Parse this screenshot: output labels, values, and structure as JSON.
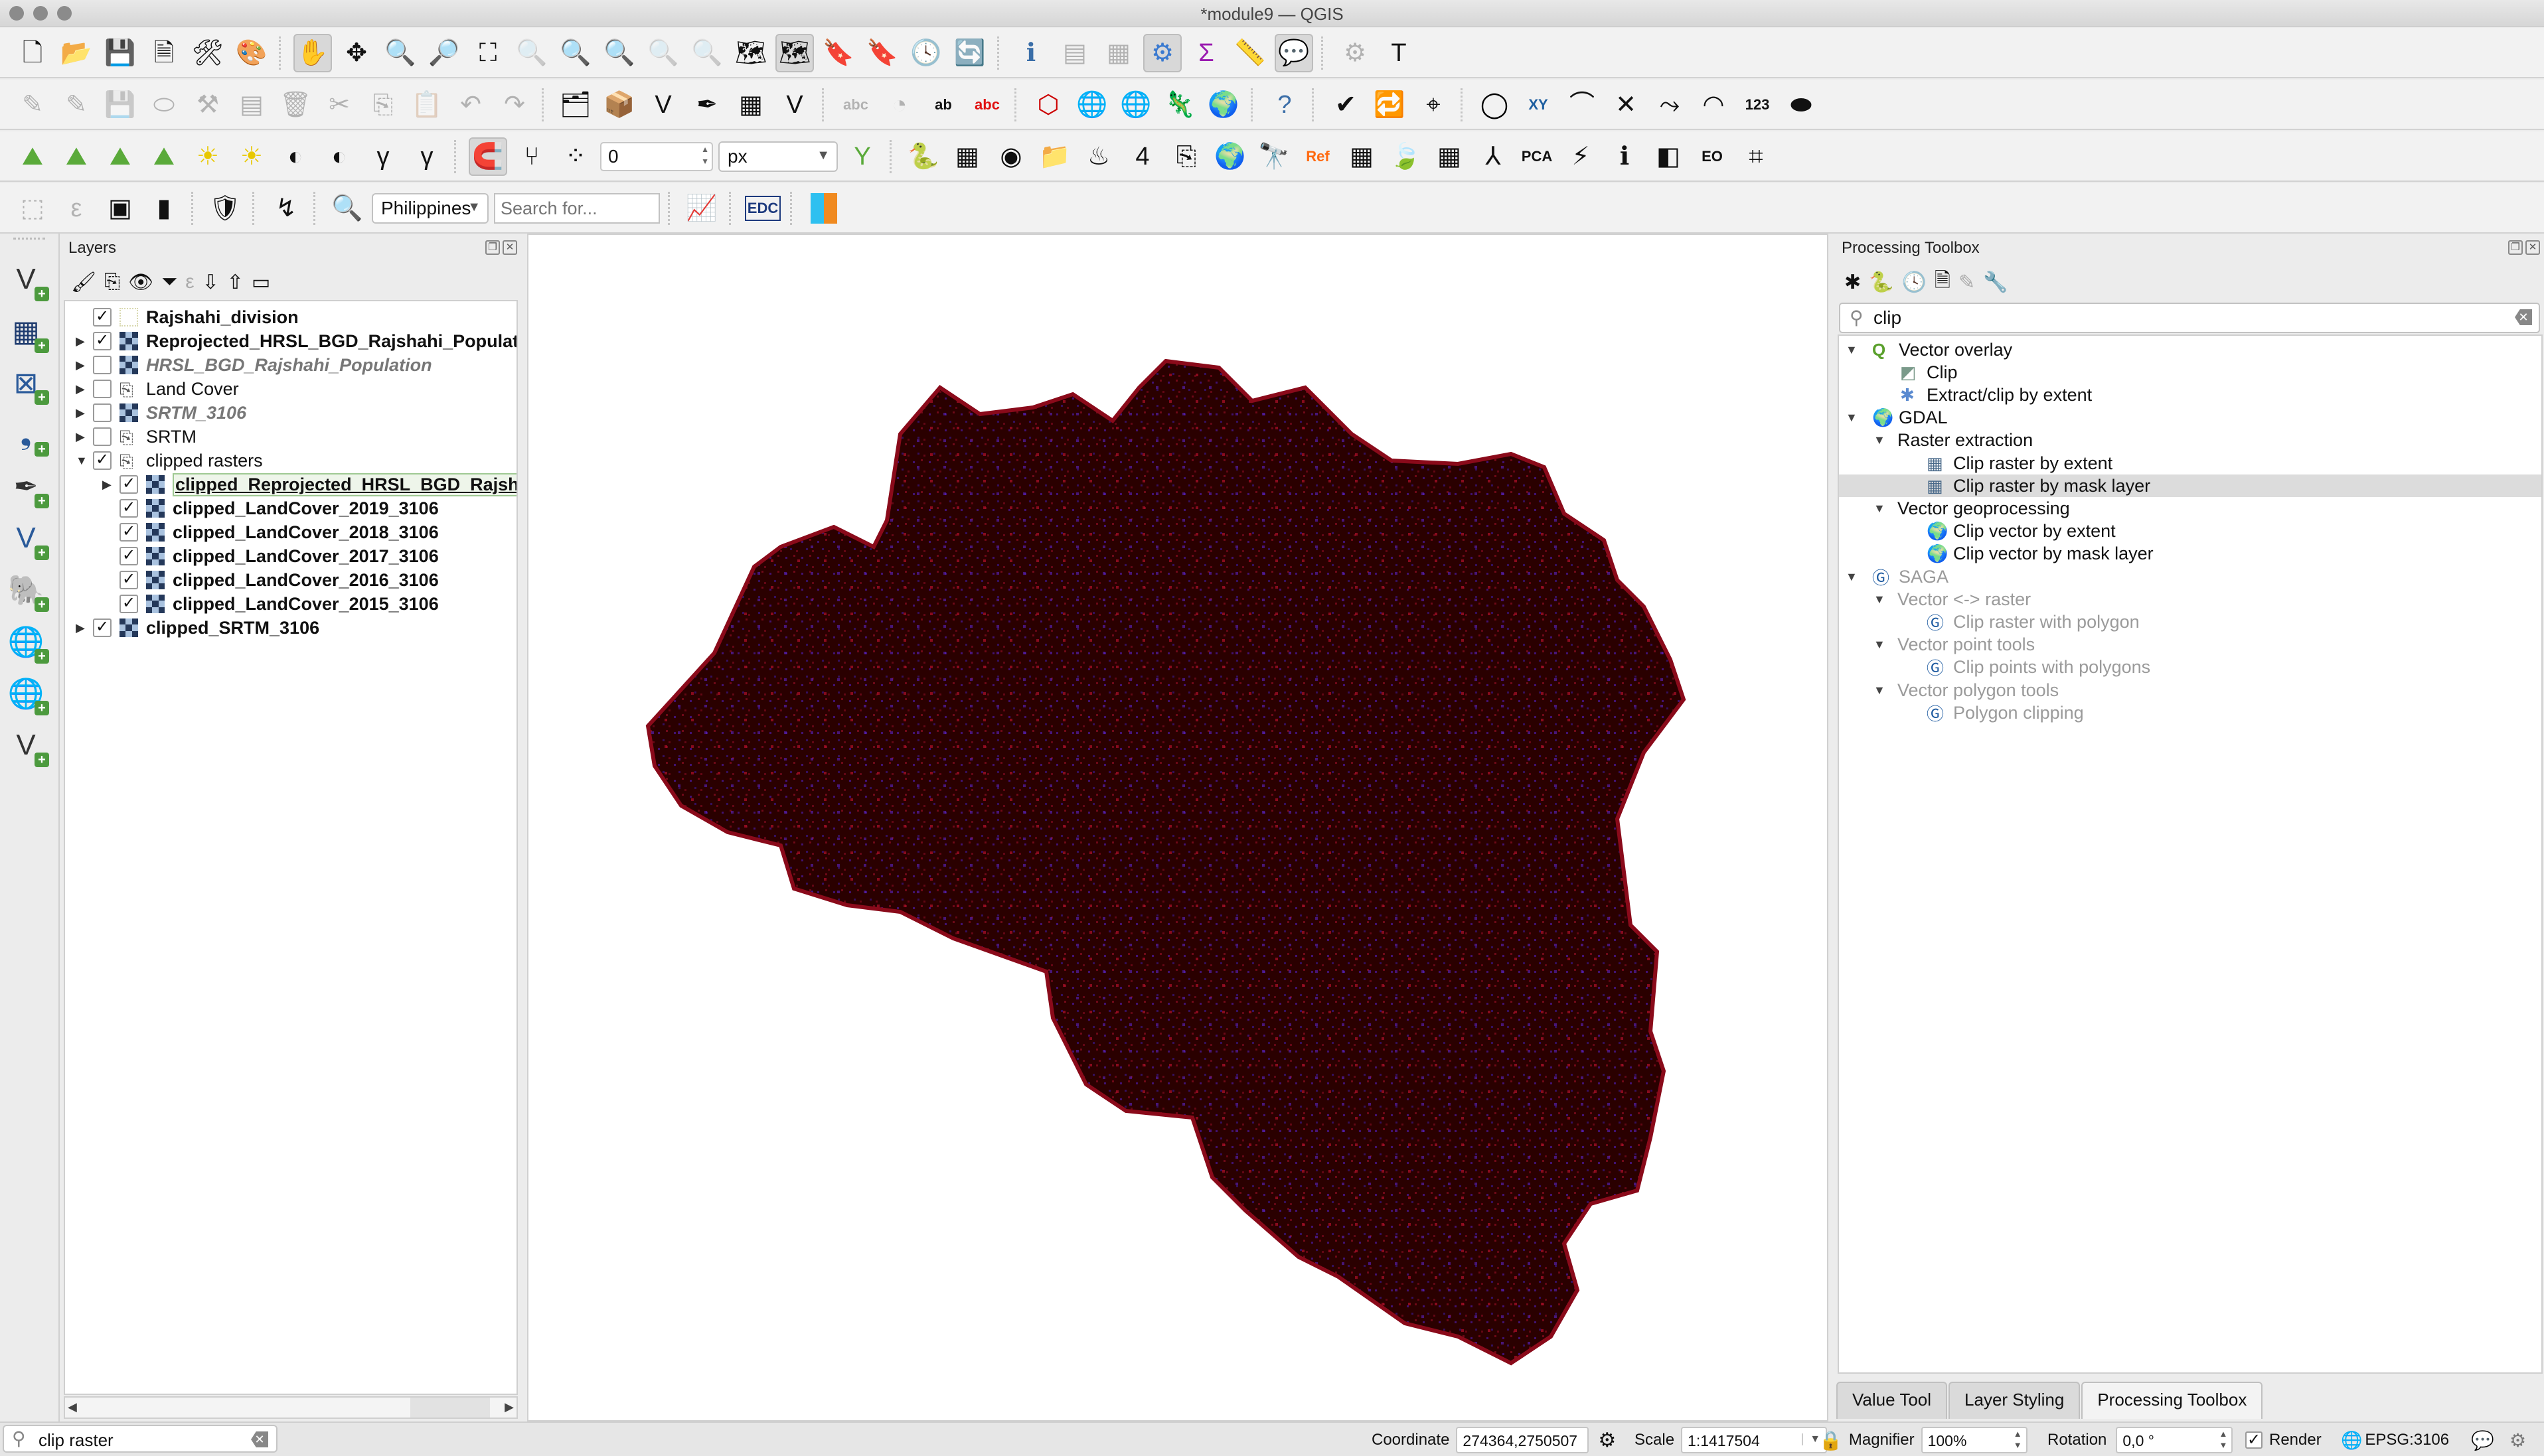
{
  "window": {
    "title": "*module9 — QGIS"
  },
  "toolbar": {
    "scale_snap_value": "0",
    "units_select": "px",
    "locator_country": "Philippines",
    "locator_search_placeholder": "Search for...",
    "edc_label": "EDC",
    "icons_row1": [
      "new-project-icon",
      "open-project-icon",
      "save-project-icon",
      "new-print-layout-icon",
      "layout-manager-icon",
      "style-manager-icon",
      "pan-icon",
      "pan-to-selection-icon",
      "zoom-in-icon",
      "zoom-out-icon",
      "zoom-full-icon",
      "zoom-to-selection-icon",
      "zoom-to-layer-icon",
      "zoom-native-icon",
      "zoom-last-icon",
      "zoom-next-icon",
      "new-map-view-icon",
      "new-3d-map-icon",
      "new-bookmark-icon",
      "show-bookmarks-icon",
      "temporal-controller-icon",
      "refresh-icon",
      "identify-icon",
      "attribute-table-icon",
      "field-calculator-icon",
      "processing-toolbox-icon",
      "statistics-icon",
      "measure-icon",
      "map-tips-icon",
      "select-feature-icon",
      "text-annotation-icon"
    ],
    "icons_row2": [
      "toggle-editing-icon",
      "current-edits-icon",
      "save-edits-icon",
      "digitize-icon",
      "vertex-tool-icon",
      "modify-attributes-icon",
      "delete-selected-icon",
      "cut-features-icon",
      "copy-features-icon",
      "paste-features-icon",
      "undo-icon",
      "redo-icon",
      "add-layer-icon",
      "new-geopackage-icon",
      "new-shapefile-icon",
      "new-spatialite-icon",
      "new-virtual-layer-icon",
      "new-scratch-layer-icon",
      "label-icon",
      "diagram-icon",
      "pin-labels-icon",
      "highlight-labels-icon",
      "topology-checker-icon",
      "wms-add-icon",
      "wfs-search-icon",
      "quick-map-services-icon",
      "geocoding-icon",
      "help-icon",
      "geometry-checker-icon",
      "table-sync-icon",
      "coordinate-capture-icon",
      "circle-icon",
      "xy-icon",
      "curve-icon",
      "split-icon",
      "trace-icon",
      "measure-angle-icon",
      "number-icon",
      "merge-icon"
    ],
    "icons_row3": [
      "histogram-stretch-full-icon",
      "histogram-stretch-local-icon",
      "cumulative-cut-full-icon",
      "cumulative-cut-local-icon",
      "brightness-up-icon",
      "brightness-down-icon",
      "contrast-up-icon",
      "contrast-down-icon",
      "gamma-up-icon",
      "gamma-down-icon",
      "snapping-icon",
      "snapping-mode-icon",
      "snapping-type-icon",
      "tracing-icon",
      "python-console-icon",
      "raster-calculator-icon",
      "semi-auto-classification-icon",
      "plugin-icon",
      "qgis2web-icon",
      "qfield-icon",
      "georeferencer-icon",
      "earth-engine-icon",
      "mapillary-icon",
      "ref-icon",
      "raster-grid-icon",
      "sentinel-icon",
      "grid-icon",
      "network-icon",
      "pca-icon",
      "profile-icon",
      "value-tool-icon",
      "split-view-icon",
      "openeo-icon",
      "buildings-icon"
    ],
    "icons_row4": [
      "select-by-area-icon",
      "select-by-expression-icon",
      "deselect-icon",
      "select-by-location-icon",
      "shield-plugin-icon",
      "route-plugin-icon",
      "locate-icon",
      "profile-chart-icon",
      "edc-icon",
      "sld-icon"
    ]
  },
  "left_toolbar": {
    "icons": [
      "add-vector-layer-icon",
      "add-raster-layer-icon",
      "add-mesh-layer-icon",
      "add-delimited-text-icon",
      "add-spatialite-icon",
      "add-virtual-layer-icon",
      "add-postgis-icon",
      "add-wms-icon",
      "add-wfs-icon",
      "add-vector-tile-icon"
    ]
  },
  "layers_panel": {
    "title": "Layers",
    "tools": [
      "style-panel-icon",
      "add-group-icon",
      "manage-visibility-icon",
      "filter-legend-icon",
      "filter-expression-icon",
      "expand-all-icon",
      "collapse-all-icon",
      "remove-layer-icon"
    ],
    "items": [
      {
        "label": "Rajshahi_division",
        "checked": true,
        "bold": true,
        "italic": false,
        "type": "vector",
        "level": 0,
        "expandable": false
      },
      {
        "label": "Reprojected_HRSL_BGD_Rajshahi_Populatio",
        "checked": true,
        "bold": true,
        "italic": false,
        "type": "raster",
        "level": 0,
        "expandable": true
      },
      {
        "label": "HRSL_BGD_Rajshahi_Population",
        "checked": false,
        "bold": true,
        "italic": true,
        "type": "raster",
        "level": 0,
        "expandable": true
      },
      {
        "label": "Land Cover",
        "checked": false,
        "bold": false,
        "italic": false,
        "type": "group",
        "level": 0,
        "expandable": true
      },
      {
        "label": "SRTM_3106",
        "checked": false,
        "bold": true,
        "italic": true,
        "type": "raster",
        "level": 0,
        "expandable": true
      },
      {
        "label": "SRTM",
        "checked": false,
        "bold": false,
        "italic": false,
        "type": "group",
        "level": 0,
        "expandable": true
      },
      {
        "label": "clipped rasters",
        "checked": true,
        "bold": false,
        "italic": false,
        "type": "group",
        "level": 0,
        "expandable": true,
        "expanded": true
      },
      {
        "label": "clipped_Reprojected_HRSL_BGD_Rajshal",
        "checked": true,
        "bold": true,
        "italic": false,
        "type": "raster",
        "level": 1,
        "expandable": true,
        "selected": true
      },
      {
        "label": "clipped_LandCover_2019_3106",
        "checked": true,
        "bold": true,
        "italic": false,
        "type": "raster",
        "level": 1,
        "expandable": false
      },
      {
        "label": "clipped_LandCover_2018_3106",
        "checked": true,
        "bold": true,
        "italic": false,
        "type": "raster",
        "level": 1,
        "expandable": false
      },
      {
        "label": "clipped_LandCover_2017_3106",
        "checked": true,
        "bold": true,
        "italic": false,
        "type": "raster",
        "level": 1,
        "expandable": false
      },
      {
        "label": "clipped_LandCover_2016_3106",
        "checked": true,
        "bold": true,
        "italic": false,
        "type": "raster",
        "level": 1,
        "expandable": false
      },
      {
        "label": "clipped_LandCover_2015_3106",
        "checked": true,
        "bold": true,
        "italic": false,
        "type": "raster",
        "level": 1,
        "expandable": false
      },
      {
        "label": "clipped_SRTM_3106",
        "checked": true,
        "bold": true,
        "italic": false,
        "type": "raster",
        "level": 0,
        "expandable": true
      }
    ]
  },
  "map": {
    "fill_color": "#2a0000",
    "highlight_red": "#b0102a",
    "highlight_blue": "#3a1a9a"
  },
  "processing_toolbox": {
    "title": "Processing Toolbox",
    "tools": [
      "models-icon",
      "scripts-icon",
      "history-icon",
      "results-viewer-icon",
      "edit-in-place-icon",
      "options-icon"
    ],
    "search_value": "clip",
    "tree": [
      {
        "label": "Vector overlay",
        "level": 0,
        "kind": "provider",
        "icon": "qgis-icon",
        "disabled": false
      },
      {
        "label": "Clip",
        "level": 2,
        "kind": "algorithm",
        "icon": "clip-icon",
        "disabled": false
      },
      {
        "label": "Extract/clip by extent",
        "level": 2,
        "kind": "algorithm",
        "icon": "gear-icon",
        "disabled": false
      },
      {
        "label": "GDAL",
        "level": 0,
        "kind": "provider",
        "icon": "gdal-icon",
        "disabled": false
      },
      {
        "label": "Raster extraction",
        "level": 1,
        "kind": "group",
        "disabled": false
      },
      {
        "label": "Clip raster by extent",
        "level": 3,
        "kind": "algorithm",
        "icon": "raster-clip-icon",
        "disabled": false
      },
      {
        "label": "Clip raster by mask layer",
        "level": 3,
        "kind": "algorithm",
        "icon": "raster-clip-icon",
        "disabled": false,
        "selected": true
      },
      {
        "label": "Vector geoprocessing",
        "level": 1,
        "kind": "group",
        "disabled": false
      },
      {
        "label": "Clip vector by extent",
        "level": 3,
        "kind": "algorithm",
        "icon": "gdal-icon",
        "disabled": false
      },
      {
        "label": "Clip vector by mask layer",
        "level": 3,
        "kind": "algorithm",
        "icon": "gdal-icon",
        "disabled": false
      },
      {
        "label": "SAGA",
        "level": 0,
        "kind": "provider",
        "icon": "saga-icon",
        "disabled": true
      },
      {
        "label": "Vector <-> raster",
        "level": 1,
        "kind": "group",
        "disabled": true
      },
      {
        "label": "Clip raster with polygon",
        "level": 3,
        "kind": "algorithm",
        "icon": "saga-icon",
        "disabled": true
      },
      {
        "label": "Vector point tools",
        "level": 1,
        "kind": "group",
        "disabled": true
      },
      {
        "label": "Clip points with polygons",
        "level": 3,
        "kind": "algorithm",
        "icon": "saga-icon",
        "disabled": true
      },
      {
        "label": "Vector polygon tools",
        "level": 1,
        "kind": "group",
        "disabled": true
      },
      {
        "label": "Polygon clipping",
        "level": 3,
        "kind": "algorithm",
        "icon": "saga-icon",
        "disabled": true
      }
    ]
  },
  "dock_tabs": [
    {
      "label": "Value Tool",
      "active": false
    },
    {
      "label": "Layer Styling",
      "active": false
    },
    {
      "label": "Processing Toolbox",
      "active": true
    }
  ],
  "statusbar": {
    "locator_value": "clip raster",
    "coordinate_label": "Coordinate",
    "coordinate_value": "274364,2750507",
    "scale_label": "Scale",
    "scale_value": "1:1417504",
    "magnifier_label": "Magnifier",
    "magnifier_value": "100%",
    "rotation_label": "Rotation",
    "rotation_value": "0,0 °",
    "render_label": "Render",
    "render_checked": true,
    "crs_label": "EPSG:3106"
  }
}
